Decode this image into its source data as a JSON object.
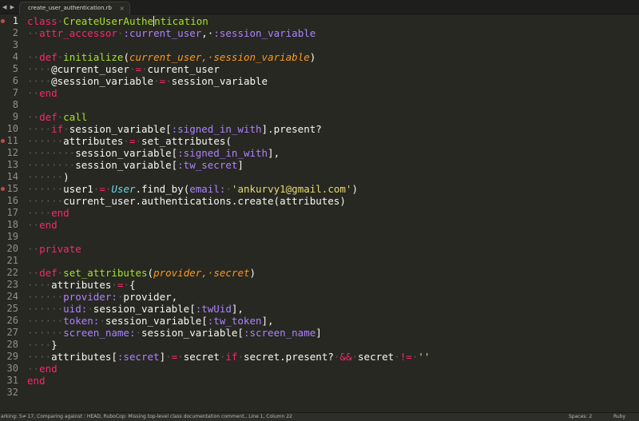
{
  "tab": {
    "nav_label": "◀ ▶",
    "filename": "create_user_authentication.rb",
    "close": "×"
  },
  "editor": {
    "active_line": 1,
    "marked_lines": [
      1,
      11,
      15
    ],
    "lines": [
      [
        [
          "kw",
          "class"
        ],
        [
          "ws",
          "·"
        ],
        [
          "cls",
          "CreateUserAuthe"
        ],
        [
          "caret",
          ""
        ],
        [
          "cls",
          "ntication"
        ]
      ],
      [
        [
          "ws",
          "··"
        ],
        [
          "kw",
          "attr_accessor"
        ],
        [
          "ws",
          "·"
        ],
        [
          "sym",
          ":current_user"
        ],
        [
          "plain",
          ",·"
        ],
        [
          "sym",
          ":session_variable"
        ]
      ],
      [],
      [
        [
          "ws",
          "··"
        ],
        [
          "kw",
          "def"
        ],
        [
          "ws",
          "·"
        ],
        [
          "fn",
          "initialize"
        ],
        [
          "plain",
          "("
        ],
        [
          "param",
          "current_user"
        ],
        [
          "param",
          ",·"
        ],
        [
          "param",
          "session_variable"
        ],
        [
          "plain",
          ")"
        ]
      ],
      [
        [
          "ws",
          "····"
        ],
        [
          "plain",
          "@current_user"
        ],
        [
          "ws",
          "·"
        ],
        [
          "kw",
          "="
        ],
        [
          "ws",
          "·"
        ],
        [
          "plain",
          "current_user"
        ]
      ],
      [
        [
          "ws",
          "····"
        ],
        [
          "plain",
          "@session_variable"
        ],
        [
          "ws",
          "·"
        ],
        [
          "kw",
          "="
        ],
        [
          "ws",
          "·"
        ],
        [
          "plain",
          "session_variable"
        ]
      ],
      [
        [
          "ws",
          "··"
        ],
        [
          "kw",
          "end"
        ]
      ],
      [],
      [
        [
          "ws",
          "··"
        ],
        [
          "kw",
          "def"
        ],
        [
          "ws",
          "·"
        ],
        [
          "fn",
          "call"
        ]
      ],
      [
        [
          "ws",
          "····"
        ],
        [
          "kw",
          "if"
        ],
        [
          "ws",
          "·"
        ],
        [
          "plain",
          "session_variable["
        ],
        [
          "sym",
          ":signed_in_with"
        ],
        [
          "plain",
          "].present?"
        ]
      ],
      [
        [
          "ws",
          "······"
        ],
        [
          "plain",
          "attributes"
        ],
        [
          "ws",
          "·"
        ],
        [
          "kw",
          "="
        ],
        [
          "ws",
          "·"
        ],
        [
          "plain",
          "set_attributes("
        ]
      ],
      [
        [
          "ws",
          "········"
        ],
        [
          "plain",
          "session_variable["
        ],
        [
          "sym",
          ":signed_in_with"
        ],
        [
          "plain",
          "],"
        ]
      ],
      [
        [
          "ws",
          "········"
        ],
        [
          "plain",
          "session_variable["
        ],
        [
          "sym",
          ":tw_secret"
        ],
        [
          "plain",
          "]"
        ]
      ],
      [
        [
          "ws",
          "······"
        ],
        [
          "plain",
          ")"
        ]
      ],
      [
        [
          "ws",
          "······"
        ],
        [
          "plain",
          "user1"
        ],
        [
          "ws",
          "·"
        ],
        [
          "kw",
          "="
        ],
        [
          "ws",
          "·"
        ],
        [
          "cnst",
          "User"
        ],
        [
          "plain",
          ".find_by("
        ],
        [
          "hashkey",
          "email:"
        ],
        [
          "ws",
          "·"
        ],
        [
          "str",
          "'ankurvy1@gmail.com'"
        ],
        [
          "plain",
          ")"
        ]
      ],
      [
        [
          "ws",
          "······"
        ],
        [
          "plain",
          "current_user.authentications.create(attributes)"
        ]
      ],
      [
        [
          "ws",
          "····"
        ],
        [
          "kw",
          "end"
        ]
      ],
      [
        [
          "ws",
          "··"
        ],
        [
          "kw",
          "end"
        ]
      ],
      [],
      [
        [
          "ws",
          "··"
        ],
        [
          "kw",
          "private"
        ]
      ],
      [],
      [
        [
          "ws",
          "··"
        ],
        [
          "kw",
          "def"
        ],
        [
          "ws",
          "·"
        ],
        [
          "fn",
          "set_attributes"
        ],
        [
          "plain",
          "("
        ],
        [
          "param",
          "provider"
        ],
        [
          "param",
          ",·"
        ],
        [
          "param",
          "secret"
        ],
        [
          "plain",
          ")"
        ]
      ],
      [
        [
          "ws",
          "····"
        ],
        [
          "plain",
          "attributes"
        ],
        [
          "ws",
          "·"
        ],
        [
          "kw",
          "="
        ],
        [
          "ws",
          "·"
        ],
        [
          "plain",
          "{"
        ]
      ],
      [
        [
          "ws",
          "······"
        ],
        [
          "hashkey",
          "provider:"
        ],
        [
          "ws",
          "·"
        ],
        [
          "plain",
          "provider,"
        ]
      ],
      [
        [
          "ws",
          "······"
        ],
        [
          "hashkey",
          "uid:"
        ],
        [
          "ws",
          "·"
        ],
        [
          "plain",
          "session_variable["
        ],
        [
          "sym",
          ":twUid"
        ],
        [
          "plain",
          "],"
        ]
      ],
      [
        [
          "ws",
          "······"
        ],
        [
          "hashkey",
          "token:"
        ],
        [
          "ws",
          "·"
        ],
        [
          "plain",
          "session_variable["
        ],
        [
          "sym",
          ":tw_token"
        ],
        [
          "plain",
          "],"
        ]
      ],
      [
        [
          "ws",
          "······"
        ],
        [
          "hashkey",
          "screen_name:"
        ],
        [
          "ws",
          "·"
        ],
        [
          "plain",
          "session_variable["
        ],
        [
          "sym",
          ":screen_name"
        ],
        [
          "plain",
          "]"
        ]
      ],
      [
        [
          "ws",
          "····"
        ],
        [
          "plain",
          "}"
        ]
      ],
      [
        [
          "ws",
          "····"
        ],
        [
          "plain",
          "attributes["
        ],
        [
          "sym",
          ":secret"
        ],
        [
          "plain",
          "]"
        ],
        [
          "ws",
          "·"
        ],
        [
          "kw",
          "="
        ],
        [
          "ws",
          "·"
        ],
        [
          "plain",
          "secret"
        ],
        [
          "ws",
          "·"
        ],
        [
          "kw",
          "if"
        ],
        [
          "ws",
          "·"
        ],
        [
          "plain",
          "secret.present?"
        ],
        [
          "ws",
          "·"
        ],
        [
          "kw",
          "&&"
        ],
        [
          "ws",
          "·"
        ],
        [
          "plain",
          "secret"
        ],
        [
          "ws",
          "·"
        ],
        [
          "kw",
          "!="
        ],
        [
          "ws",
          "·"
        ],
        [
          "str",
          "''"
        ]
      ],
      [
        [
          "ws",
          "··"
        ],
        [
          "kw",
          "end"
        ]
      ],
      [
        [
          "kw",
          "end"
        ]
      ],
      []
    ]
  },
  "status": {
    "left": "arking: 5≠ 17, Comparing against : HEAD, RuboCop: Missing top-level class documentation comment., Line 1, Column 22",
    "spaces": "Spaces: 2",
    "syntax": "Ruby"
  },
  "colors": {
    "background": "#272822",
    "keyword": "#f92672",
    "function": "#a6e22e",
    "parameter": "#fd971f",
    "symbol": "#ae81ff",
    "string": "#e6db74",
    "constant": "#66d9ef"
  }
}
